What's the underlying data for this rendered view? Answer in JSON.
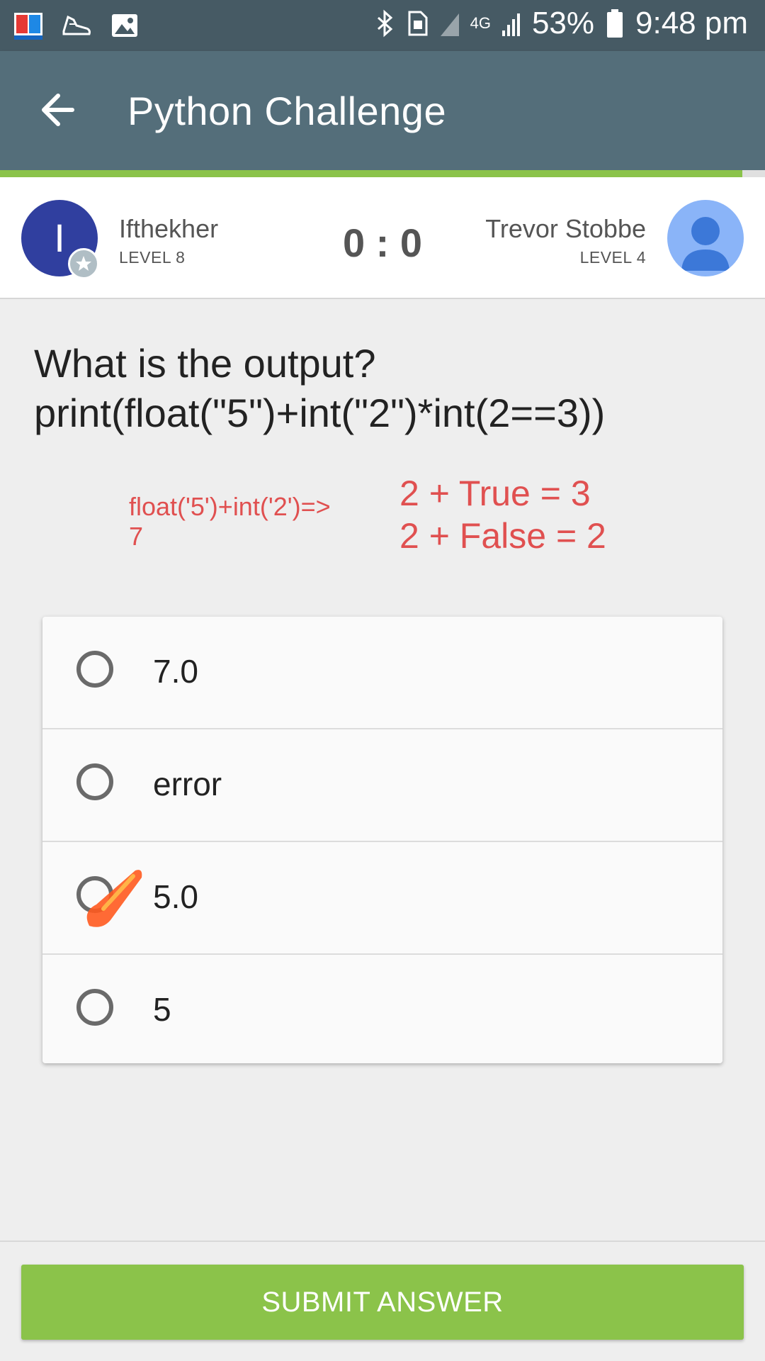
{
  "status_bar": {
    "battery": "53%",
    "time": "9:48 pm",
    "network": "4G",
    "icons": [
      "dictionary-app-icon",
      "shoe-icon",
      "image-icon",
      "bluetooth-icon",
      "sim-icon",
      "signal-icon",
      "battery-icon"
    ]
  },
  "app_bar": {
    "title": "Python Challenge",
    "back_icon": "arrow-back-icon"
  },
  "progress": {
    "fraction": 0.97,
    "color": "#8bc34a"
  },
  "players": {
    "left": {
      "initial": "I",
      "name": "Ifthekher",
      "level": "LEVEL 8",
      "avatar_color": "#303f9f"
    },
    "score": "0 : 0",
    "right": {
      "name": "Trevor Stobbe",
      "level": "LEVEL 4",
      "avatar_color": "#8ab4f8"
    }
  },
  "question": {
    "line1": "What is the output?",
    "line2": "print(float(\"5\")+int(\"2\")*int(2==3))"
  },
  "annotations": {
    "note1_line1": "float('5')+int('2')=>",
    "note1_line2": "7",
    "note2_line1": "2 + True = 3",
    "note2_line2": "2 + False = 2",
    "color": "#e05050"
  },
  "options": [
    {
      "label": "7.0",
      "marked": false
    },
    {
      "label": "error",
      "marked": false
    },
    {
      "label": "5.0",
      "marked": true
    },
    {
      "label": "5",
      "marked": false
    }
  ],
  "submit_label": "SUBMIT ANSWER",
  "colors": {
    "primary": "#546e7a",
    "status_bar": "#465a64",
    "accent": "#8bc34a"
  }
}
